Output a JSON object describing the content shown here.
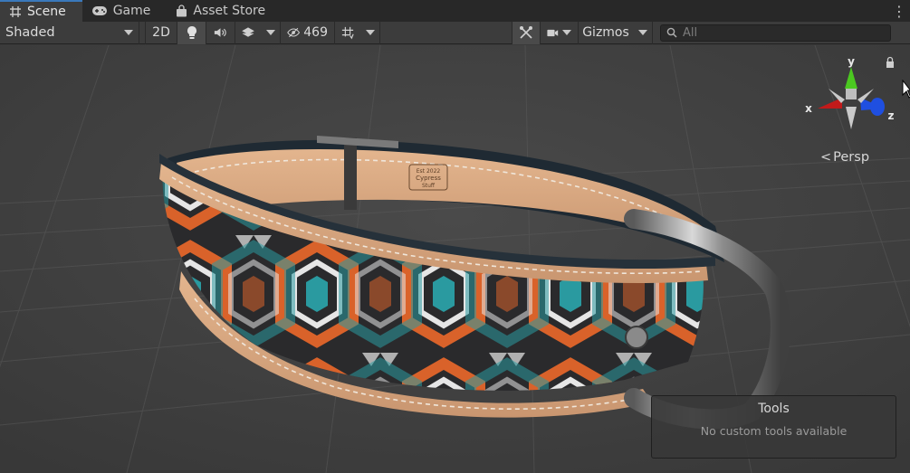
{
  "tabs": [
    {
      "label": "Scene",
      "icon": "grid-hash-icon",
      "active": true
    },
    {
      "label": "Game",
      "icon": "gamepad-icon",
      "active": false
    },
    {
      "label": "Asset Store",
      "icon": "shopping-bag-icon",
      "active": false
    }
  ],
  "toolbar": {
    "shading_mode": "Shaded",
    "mode_2d": "2D",
    "hidden_count": "469",
    "gizmos_label": "Gizmos",
    "search_placeholder": "All"
  },
  "gizmo": {
    "axis_y": "y",
    "axis_x": "x",
    "axis_z": "z",
    "projection": "Persp",
    "colors": {
      "x": "#c21a1a",
      "y": "#4bc820",
      "z": "#1f4fe0"
    }
  },
  "tools_overlay": {
    "title": "Tools",
    "message": "No custom tools available"
  },
  "collar_label": {
    "line1": "Est 2022",
    "line2": "Cypress",
    "line3": "Stuff"
  }
}
